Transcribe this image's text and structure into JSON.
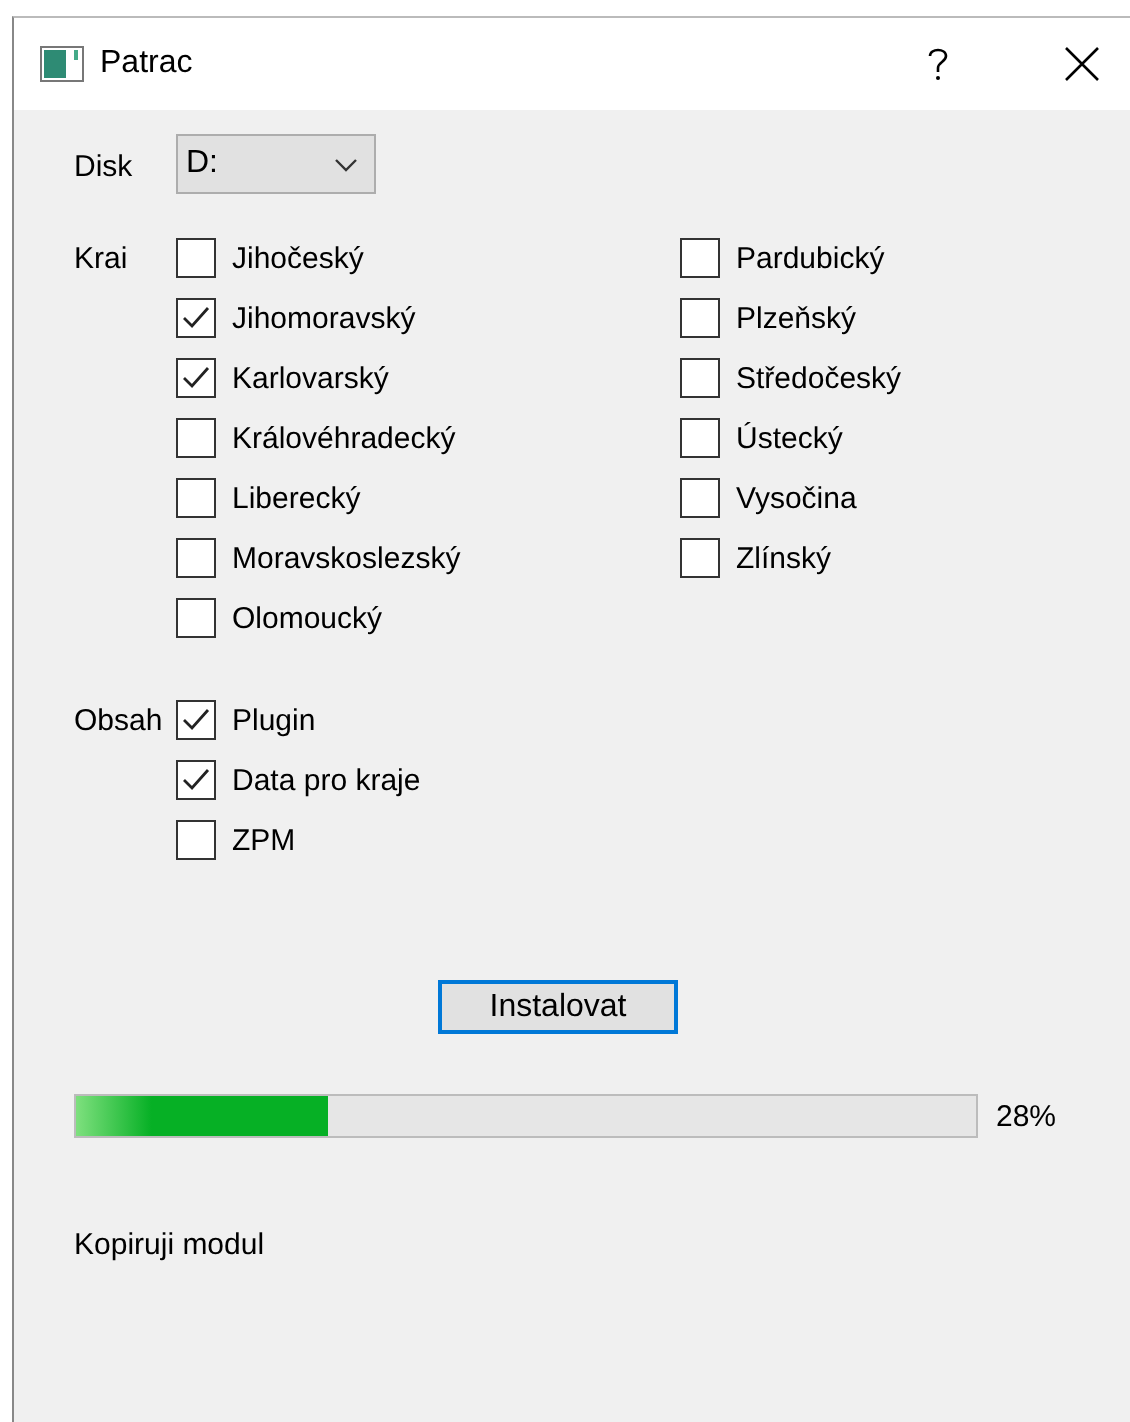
{
  "window": {
    "title": "Patrac"
  },
  "disk": {
    "label": "Disk",
    "value": "D:"
  },
  "kraj": {
    "label": "Krai",
    "columns": [
      [
        {
          "label": "Jihočeský",
          "checked": false
        },
        {
          "label": "Jihomoravský",
          "checked": true
        },
        {
          "label": "Karlovarský",
          "checked": true
        },
        {
          "label": "Královéhradecký",
          "checked": false
        },
        {
          "label": "Liberecký",
          "checked": false
        },
        {
          "label": "Moravskoslezský",
          "checked": false
        },
        {
          "label": "Olomoucký",
          "checked": false
        }
      ],
      [
        {
          "label": "Pardubický",
          "checked": false
        },
        {
          "label": "Plzeňský",
          "checked": false
        },
        {
          "label": "Středočeský",
          "checked": false
        },
        {
          "label": "Ústecký",
          "checked": false
        },
        {
          "label": "Vysočina",
          "checked": false
        },
        {
          "label": "Zlínský",
          "checked": false
        }
      ]
    ]
  },
  "obsah": {
    "label": "Obsah",
    "items": [
      {
        "label": "Plugin",
        "checked": true
      },
      {
        "label": "Data pro kraje",
        "checked": true
      },
      {
        "label": "ZPM",
        "checked": false
      }
    ]
  },
  "install_button": {
    "label": "Instalovat"
  },
  "progress": {
    "level": 0.28,
    "reading": "28%"
  },
  "status": "Kopiruji modul"
}
